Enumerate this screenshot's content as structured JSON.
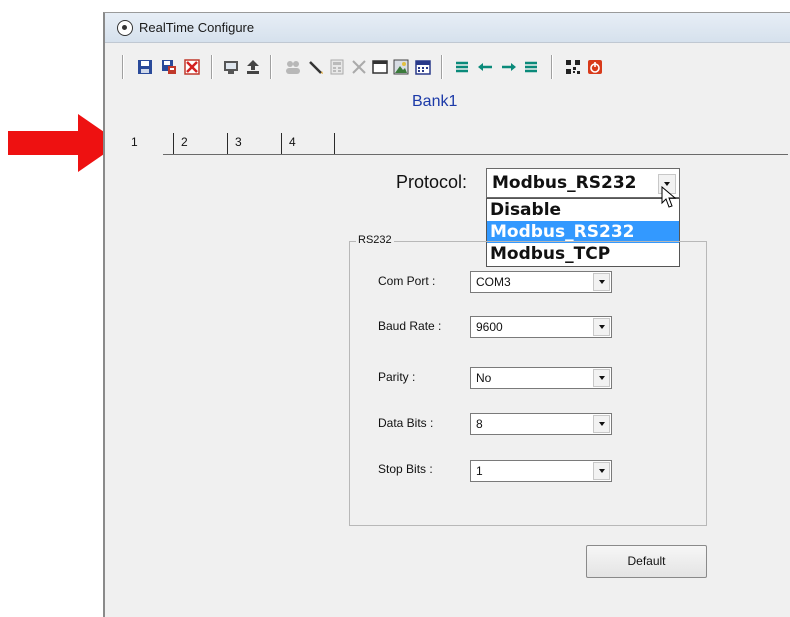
{
  "window": {
    "title": "RealTime Configure"
  },
  "toolbar": {
    "buttons": [
      "save-icon",
      "save-as-icon",
      "delete-icon",
      "monitor-icon",
      "upload-icon",
      "users-icon",
      "pencil-icon",
      "calculator-icon",
      "tools-icon",
      "window-icon",
      "image-icon",
      "calendar-icon",
      "first-icon",
      "previous-icon",
      "next-icon",
      "last-icon",
      "qr-code-icon",
      "power-icon"
    ]
  },
  "bank": {
    "title": "Bank1"
  },
  "tabs": [
    "1",
    "2",
    "3",
    "4"
  ],
  "protocol": {
    "label": "Protocol:",
    "value": "Modbus_RS232",
    "options": [
      "Disable",
      "Modbus_RS232",
      "Modbus_TCP"
    ],
    "selected_option": "Modbus_RS232"
  },
  "rs232": {
    "group_label": "RS232",
    "fields": [
      {
        "label": "Com Port :",
        "value": "COM3"
      },
      {
        "label": "Baud Rate :",
        "value": "9600"
      },
      {
        "label": "Parity :",
        "value": "No"
      },
      {
        "label": "Data Bits :",
        "value": "8"
      },
      {
        "label": "Stop Bits :",
        "value": "1"
      }
    ]
  },
  "buttons": {
    "default_label": "Default"
  },
  "colors": {
    "annotation_arrow": "#ee1111",
    "bank_title": "#1c3aa8",
    "selection": "#3399ff"
  }
}
